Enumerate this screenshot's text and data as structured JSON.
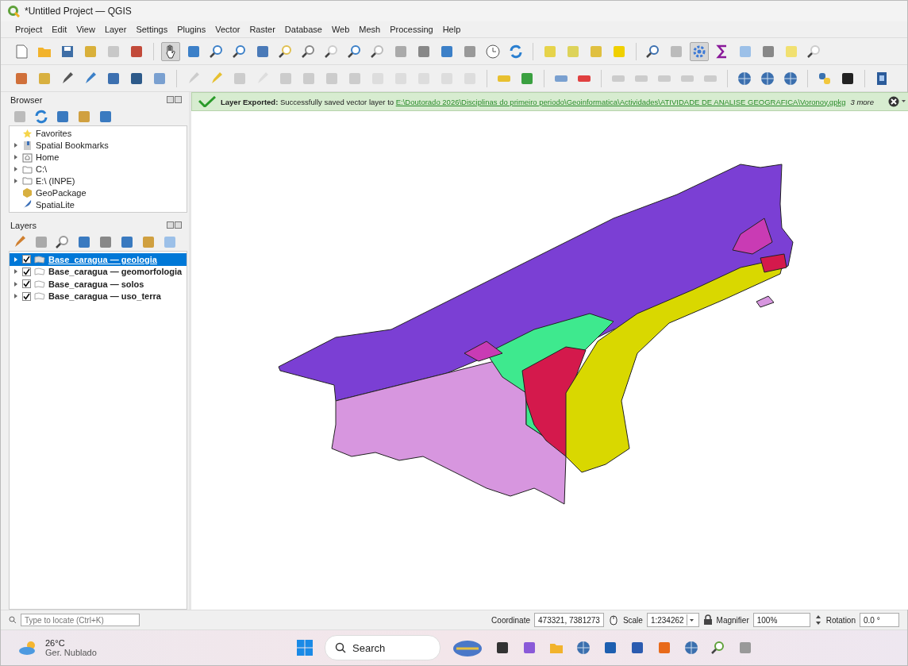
{
  "window": {
    "title": "*Untitled Project — QGIS"
  },
  "menu": [
    "Project",
    "Edit",
    "View",
    "Layer",
    "Settings",
    "Plugins",
    "Vector",
    "Raster",
    "Database",
    "Web",
    "Mesh",
    "Processing",
    "Help"
  ],
  "browser": {
    "title": "Browser",
    "items": [
      {
        "label": "Favorites",
        "expandable": false
      },
      {
        "label": "Spatial Bookmarks",
        "expandable": true
      },
      {
        "label": "Home",
        "expandable": true
      },
      {
        "label": "C:\\",
        "expandable": true
      },
      {
        "label": "E:\\ (INPE)",
        "expandable": true
      },
      {
        "label": "GeoPackage",
        "expandable": false
      },
      {
        "label": "SpatiaLite",
        "expandable": false
      }
    ]
  },
  "layers": {
    "title": "Layers",
    "items": [
      {
        "label": "Base_caragua — geologia",
        "checked": true,
        "selected": true
      },
      {
        "label": "Base_caragua — geomorfologia",
        "checked": true,
        "selected": false
      },
      {
        "label": "Base_caragua — solos",
        "checked": true,
        "selected": false
      },
      {
        "label": "Base_caragua — uso_terra",
        "checked": true,
        "selected": false
      }
    ]
  },
  "message_bar": {
    "title": "Layer Exported:",
    "text": "Successfully saved vector layer to",
    "link": "E:\\Doutorado 2026\\Disciplinas do primeiro periodo\\Geoinformatica\\Actividades\\ATIVIDADE DE ANALISE GEOGRAFICA\\Voronoy.gpkg",
    "more": "3 more"
  },
  "status_bar": {
    "locate_placeholder": "Type to locate (Ctrl+K)",
    "coordinate_label": "Coordinate",
    "coordinate": "473321, 7381273",
    "scale_label": "Scale",
    "scale": "1:234262",
    "magnifier_label": "Magnifier",
    "magnifier": "100%",
    "rotation_label": "Rotation",
    "rotation": "0.0 °"
  },
  "taskbar": {
    "temperature": "26°C",
    "weather": "Ger. Nublado",
    "search": "Search"
  }
}
